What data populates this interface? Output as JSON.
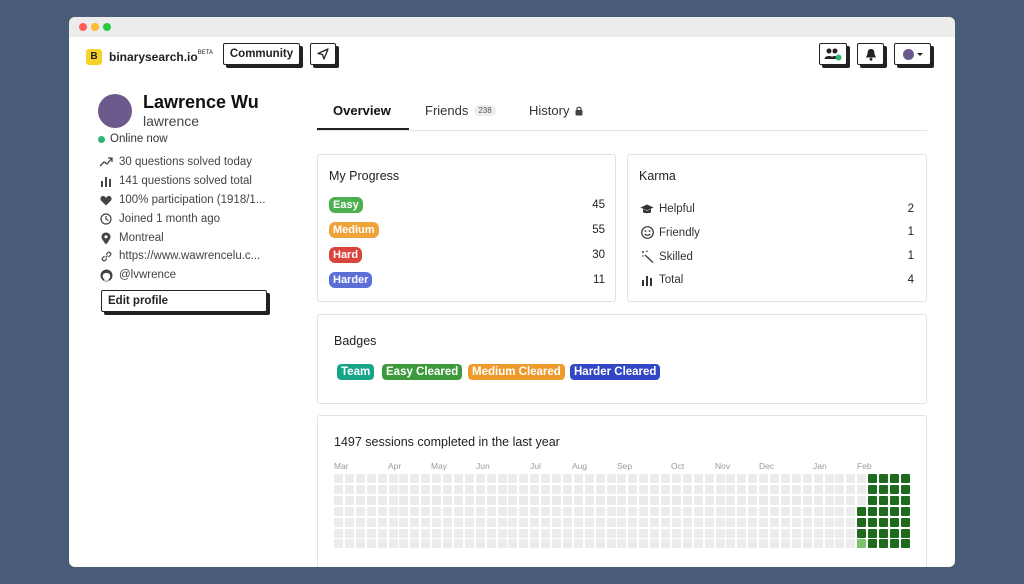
{
  "header": {
    "logo_letter": "B",
    "brand": "binarysearch.io",
    "brand_badge": "BETA",
    "community_label": "Community",
    "send_icon": "paper-plane-icon",
    "people_icon": "people-icon",
    "bell_icon": "bell-icon"
  },
  "profile": {
    "name": "Lawrence Wu",
    "username": "lawrence",
    "status": "Online now",
    "stats": [
      {
        "icon": "trending-icon",
        "text": "30 questions solved today"
      },
      {
        "icon": "bar-chart-icon",
        "text": "141 questions solved total"
      },
      {
        "icon": "heart-icon",
        "text": "100% participation (1918/1..."
      },
      {
        "icon": "clock-icon",
        "text": "Joined 1 month ago"
      },
      {
        "icon": "location-icon",
        "text": "Montreal"
      },
      {
        "icon": "link-icon",
        "text": "https://www.wawrencelu.c..."
      },
      {
        "icon": "github-icon",
        "text": "@lvwrence"
      }
    ],
    "edit_label": "Edit profile"
  },
  "tabs": [
    {
      "label": "Overview",
      "active": true
    },
    {
      "label": "Friends",
      "count": "238"
    },
    {
      "label": "History",
      "locked": true
    }
  ],
  "progress": {
    "title": "My Progress",
    "items": [
      {
        "label": "Easy",
        "value": "45",
        "color": "#4caf50"
      },
      {
        "label": "Medium",
        "value": "55",
        "color": "#f0a33a"
      },
      {
        "label": "Hard",
        "value": "30",
        "color": "#d9443c"
      },
      {
        "label": "Harder",
        "value": "11",
        "color": "#5b6fd6"
      }
    ]
  },
  "karma": {
    "title": "Karma",
    "items": [
      {
        "icon": "graduation-cap-icon",
        "label": "Helpful",
        "value": "2"
      },
      {
        "icon": "smile-icon",
        "label": "Friendly",
        "value": "1"
      },
      {
        "icon": "magic-wand-icon",
        "label": "Skilled",
        "value": "1"
      },
      {
        "icon": "bar-chart-icon",
        "label": "Total",
        "value": "4"
      }
    ]
  },
  "badges": {
    "title": "Badges",
    "items": [
      {
        "label": "Team",
        "color": "#17a589"
      },
      {
        "label": "Easy Cleared",
        "color": "#3c9a3c"
      },
      {
        "label": "Medium Cleared",
        "color": "#ef9b2b"
      },
      {
        "label": "Harder Cleared",
        "color": "#3346c4"
      }
    ]
  },
  "activity": {
    "title": "1497 sessions completed in the last year",
    "months": [
      "Mar",
      "Apr",
      "May",
      "Jun",
      "Jul",
      "Aug",
      "Sep",
      "Oct",
      "Nov",
      "Dec",
      "Jan",
      "Feb"
    ],
    "colors": {
      "empty": "#ebebeb",
      "dark": "#1e6b1e",
      "light": "#7cc36b"
    }
  }
}
